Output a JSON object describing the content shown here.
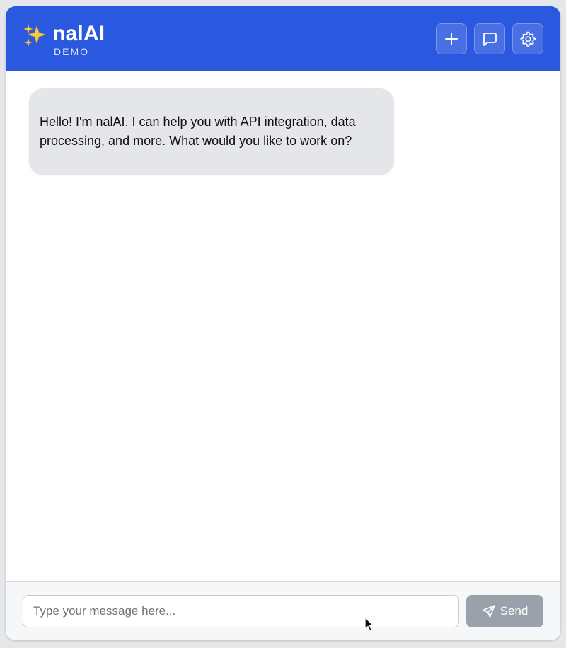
{
  "header": {
    "title": "nalAI",
    "subtitle": "DEMO",
    "logo_icon": "sparkles-icon",
    "background_color": "#2a59e0",
    "actions": [
      {
        "name": "new-chat",
        "icon": "plus-icon"
      },
      {
        "name": "conversations",
        "icon": "chat-bubble-icon"
      },
      {
        "name": "settings",
        "icon": "gear-icon"
      }
    ]
  },
  "messages": [
    {
      "role": "assistant",
      "text": "Hello! I'm nalAI. I can help you with API integration, data processing, and more. What would you like to work on?"
    }
  ],
  "composer": {
    "placeholder": "Type your message here...",
    "value": "",
    "send_label": "Send",
    "send_icon": "paper-plane-icon"
  }
}
